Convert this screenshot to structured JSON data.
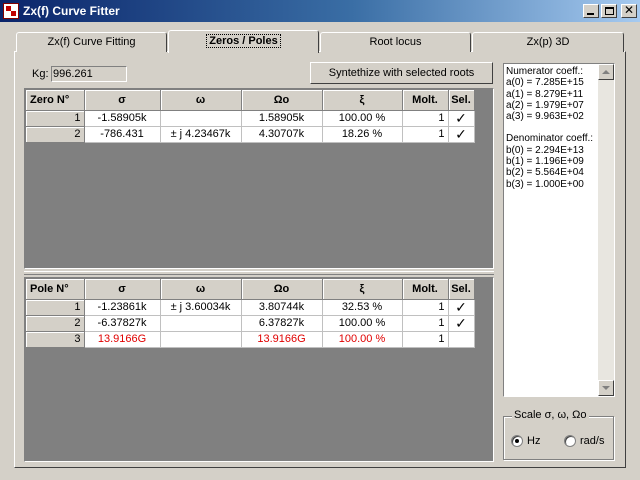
{
  "window": {
    "title": "Zx(f) Curve Fitter",
    "controls": {
      "minimize": "",
      "maximize": "",
      "close": "✕"
    }
  },
  "tabs": [
    {
      "label": "Zx(f) Curve Fitting",
      "active": false
    },
    {
      "label": "Zeros / Poles",
      "active": true
    },
    {
      "label": "Root locus",
      "active": false
    },
    {
      "label": "Zx(p) 3D",
      "active": false
    }
  ],
  "kg": {
    "label": "Kg:",
    "value": "996.261"
  },
  "synth_button": "Syntethize with selected roots",
  "zeros": {
    "headers": [
      "Zero N°",
      "σ",
      "ω",
      "Ωo",
      "ξ",
      "Molt.",
      "Sel."
    ],
    "rows": [
      {
        "n": "1",
        "sigma": "-1.58905k",
        "omega": "",
        "omega0": "1.58905k",
        "xi": "100.00 %",
        "molt": "1",
        "sel": "✓",
        "red": false
      },
      {
        "n": "2",
        "sigma": "-786.431",
        "omega": "± j 4.23467k",
        "omega0": "4.30707k",
        "xi": "18.26 %",
        "molt": "1",
        "sel": "✓",
        "red": false
      }
    ]
  },
  "poles": {
    "headers": [
      "Pole N°",
      "σ",
      "ω",
      "Ωo",
      "ξ",
      "Molt.",
      "Sel."
    ],
    "rows": [
      {
        "n": "1",
        "sigma": "-1.23861k",
        "omega": "± j 3.60034k",
        "omega0": "3.80744k",
        "xi": "32.53 %",
        "molt": "1",
        "sel": "✓",
        "red": false
      },
      {
        "n": "2",
        "sigma": "-6.37827k",
        "omega": "",
        "omega0": "6.37827k",
        "xi": "100.00 %",
        "molt": "1",
        "sel": "✓",
        "red": false
      },
      {
        "n": "3",
        "sigma": "13.9166G",
        "omega": "",
        "omega0": "13.9166G",
        "xi": "100.00 %",
        "molt": "1",
        "sel": "",
        "red": true
      }
    ]
  },
  "coefficients": {
    "numerator_title": "Numerator coeff.:",
    "numerator": [
      "a(0) = 7.285E+15",
      "a(1) = 8.279E+11",
      "a(2) = 1.979E+07",
      "a(3) = 9.963E+02"
    ],
    "denominator_title": "Denominator coeff.:",
    "denominator": [
      "b(0) = 2.294E+13",
      "b(1) = 1.196E+09",
      "b(2) = 5.564E+04",
      "b(3) = 1.000E+00"
    ]
  },
  "scale": {
    "legend": "Scale σ, ω, Ωo",
    "options": [
      {
        "label": "Hz",
        "checked": true
      },
      {
        "label": "rad/s",
        "checked": false
      }
    ]
  },
  "colors": {
    "title_start": "#0a246a",
    "title_end": "#a6caf0",
    "face": "#d4d0c8",
    "grid_bg": "#808080",
    "highlight_red": "#e00000"
  }
}
